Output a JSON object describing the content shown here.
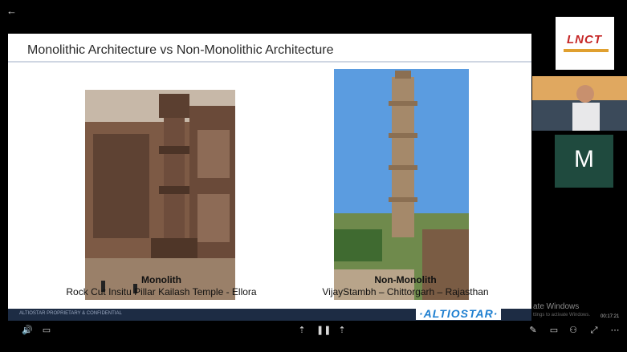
{
  "slide": {
    "title": "Monolithic Architecture vs Non-Monolithic Architecture",
    "left": {
      "heading": "Monolith",
      "caption": "Rock Cut Insitu Pillar Kailash Temple - Ellora"
    },
    "right": {
      "heading": "Non-Monolith",
      "caption": "VijayStambh – Chittorgarh – Rajasthan"
    },
    "footer_left": "ALTIOSTAR PROPRIETARY & CONFIDENTIAL",
    "footer_logo": "·ALTIOSTAR·"
  },
  "participants": {
    "logo_text": "LNCT",
    "m_initial": "M"
  },
  "windows_notice": {
    "line1": "ate Windows",
    "line2": "ttings to activate Windows."
  },
  "clock": "00:17:21",
  "colors": {
    "slide_footer": "#1d2c44",
    "brand_blue": "#1e7fd0",
    "m_tile": "#1f4a3e"
  }
}
